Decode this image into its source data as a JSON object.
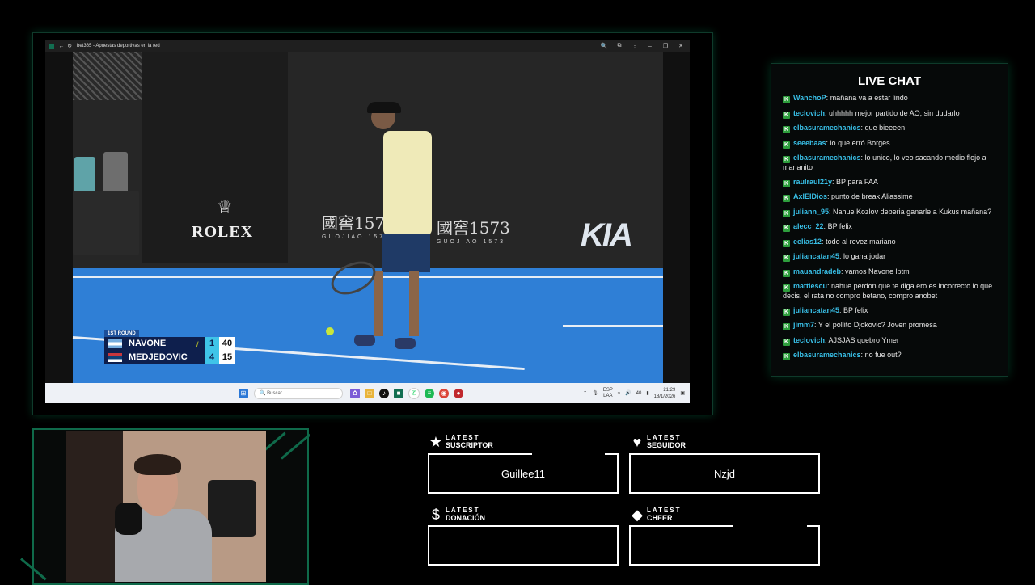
{
  "browser": {
    "tab_title": "bet365 - Apuestas deportivas en la red"
  },
  "broadcast": {
    "sponsors": {
      "rolex": "ROLEX",
      "guojiao_zh": "國窖1573",
      "guojiao_sub": "GUOJIAO 1573",
      "kia": "KIA"
    },
    "scoreboard": {
      "round": "1ST ROUND",
      "players": [
        {
          "name": "NAVONE",
          "sets": "1",
          "points": "40",
          "serving": true
        },
        {
          "name": "MEDJEDOVIC",
          "sets": "4",
          "points": "15",
          "serving": false
        }
      ]
    }
  },
  "taskbar": {
    "search_placeholder": "Buscar",
    "lang_top": "ESP",
    "lang_bottom": "LAA",
    "volume": "40",
    "time": "21:29",
    "date": "18/1/2026"
  },
  "chat": {
    "title": "LIVE CHAT",
    "messages": [
      {
        "user": "WanchoP",
        "text": "mañana va a estar lindo"
      },
      {
        "user": "teclovich",
        "text": "uhhhhh mejor partido de AO, sin dudarlo"
      },
      {
        "user": "elbasuramechanics",
        "text": "que bieeeen"
      },
      {
        "user": "seeebaas",
        "text": "lo que erró Borges"
      },
      {
        "user": "elbasuramechanics",
        "text": "lo unico, lo veo sacando medio flojo a marianito"
      },
      {
        "user": "raulraul21y",
        "text": "BP para FAA"
      },
      {
        "user": "AxlElDios",
        "text": "punto de break Aliassime"
      },
      {
        "user": "juliann_95",
        "text": "Nahue Kozlov deberia ganarle a Kukus mañana?"
      },
      {
        "user": "alecc_22",
        "text": "BP felix"
      },
      {
        "user": "eelias12",
        "text": "todo al revez mariano"
      },
      {
        "user": "juliancatan45",
        "text": "lo gana jodar"
      },
      {
        "user": "mauandradeb",
        "text": "vamos Navone lptm"
      },
      {
        "user": "mattiescu",
        "text": "nahue perdon que te diga ero es incorrecto lo que decis, el rata no compro betano, compro anobet"
      },
      {
        "user": "juliancatan45",
        "text": "BP felix"
      },
      {
        "user": "jimm7",
        "text": "Y el pollito Djokovic? Joven promesa"
      },
      {
        "user": "teclovich",
        "text": "AJSJAS quebro Ymer"
      },
      {
        "user": "elbasuramechanics",
        "text": "no fue out?"
      }
    ]
  },
  "alerts": {
    "subscriber": {
      "top": "LATEST",
      "bottom": "SUSCRIPTOR",
      "value": "Guillee11",
      "icon": "star-icon"
    },
    "follower": {
      "top": "LATEST",
      "bottom": "SEGUIDOR",
      "value": "Nzjd",
      "icon": "heart-icon"
    },
    "donation": {
      "top": "LATEST",
      "bottom": "DONACIÓN",
      "value": "",
      "icon": "dollar-icon"
    },
    "cheer": {
      "top": "LATEST",
      "bottom": "CHEER",
      "value": "",
      "icon": "diamond-icon"
    }
  },
  "colors": {
    "accent_green": "#0f6a4a",
    "chat_username": "#39c0e8",
    "chat_badge": "#2e9e3d",
    "scoreboard_navy": "#0e1f4d",
    "scoreboard_cyan": "#3fc4e8"
  }
}
